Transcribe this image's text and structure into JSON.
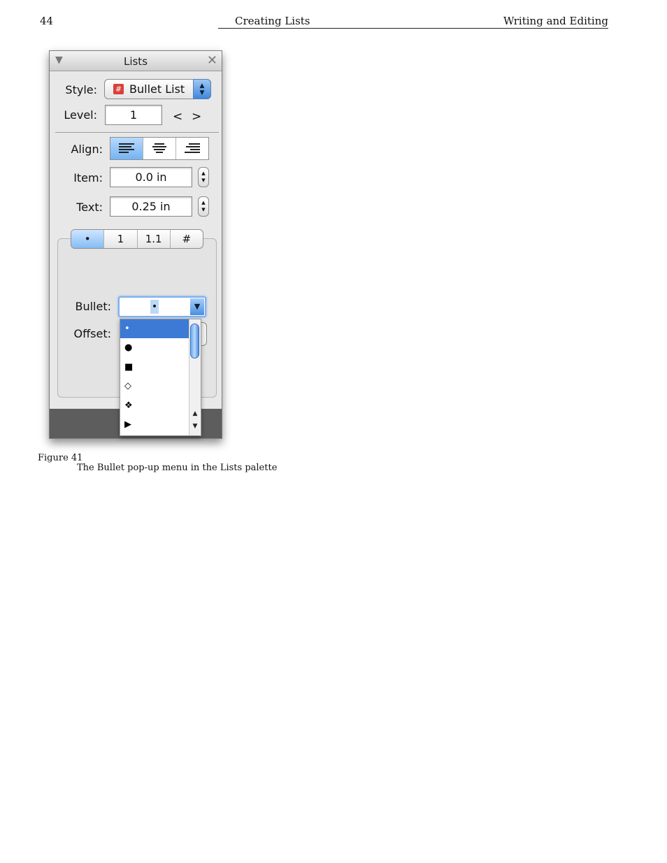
{
  "header": {
    "page_number": "44",
    "section_title": "Creating Lists",
    "chapter_title": "Writing and Editing"
  },
  "palette": {
    "title": "Lists",
    "style_label": "Style:",
    "style_value": "Bullet List",
    "style_icon": "#",
    "level_label": "Level:",
    "level_value": "1",
    "level_prev": "<",
    "level_next": ">",
    "align_label": "Align:",
    "item_label": "Item:",
    "item_value": "0.0 in",
    "text_label": "Text:",
    "text_value": "0.25 in",
    "tabs": [
      "•",
      "1",
      "1.1",
      "#"
    ],
    "bullet_label": "Bullet:",
    "bullet_value": "•",
    "offset_label": "Offset:",
    "bullet_options": [
      "•",
      "●",
      "■",
      "◇",
      "❖",
      "▶"
    ],
    "accent_color": "#3d7ad6"
  },
  "figure": {
    "label": "Figure 41",
    "caption": "The Bullet pop-up menu in the Lists palette"
  }
}
